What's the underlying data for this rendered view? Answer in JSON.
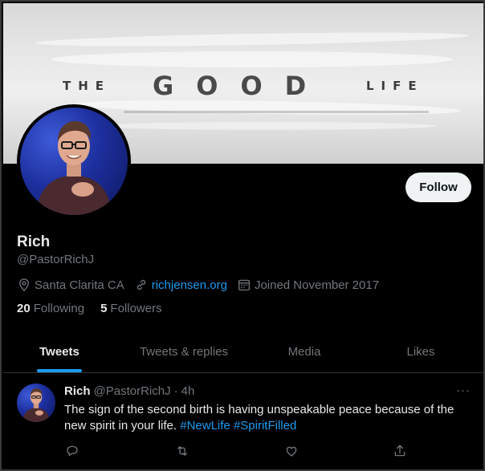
{
  "banner": {
    "word_the": "THE",
    "word_good": "GOOD",
    "word_life": "LIFE"
  },
  "profile": {
    "name": "Rich",
    "handle": "@PastorRichJ",
    "location": "Santa Clarita CA",
    "website": "richjensen.org",
    "joined": "Joined November 2017",
    "following_count": "20",
    "following_label": "Following",
    "followers_count": "5",
    "followers_label": "Followers",
    "follow_button": "Follow"
  },
  "tabs": [
    {
      "label": "Tweets",
      "active": true
    },
    {
      "label": "Tweets & replies",
      "active": false
    },
    {
      "label": "Media",
      "active": false
    },
    {
      "label": "Likes",
      "active": false
    }
  ],
  "tweet": {
    "author": "Rich",
    "handle": "@PastorRichJ",
    "separator": "·",
    "time": "4h",
    "more": "···",
    "text": "The sign of the second birth is having unspeakable peace because of the new spirit in your life.",
    "hashtags": [
      "#NewLife",
      "#SpiritFilled"
    ]
  },
  "colors": {
    "accent": "#1d9bf0",
    "background": "#000000",
    "text": "#e7e9ea",
    "muted": "#71767b"
  },
  "icons": [
    "location-icon",
    "link-icon",
    "calendar-icon",
    "reply-icon",
    "retweet-icon",
    "like-icon",
    "share-icon"
  ]
}
